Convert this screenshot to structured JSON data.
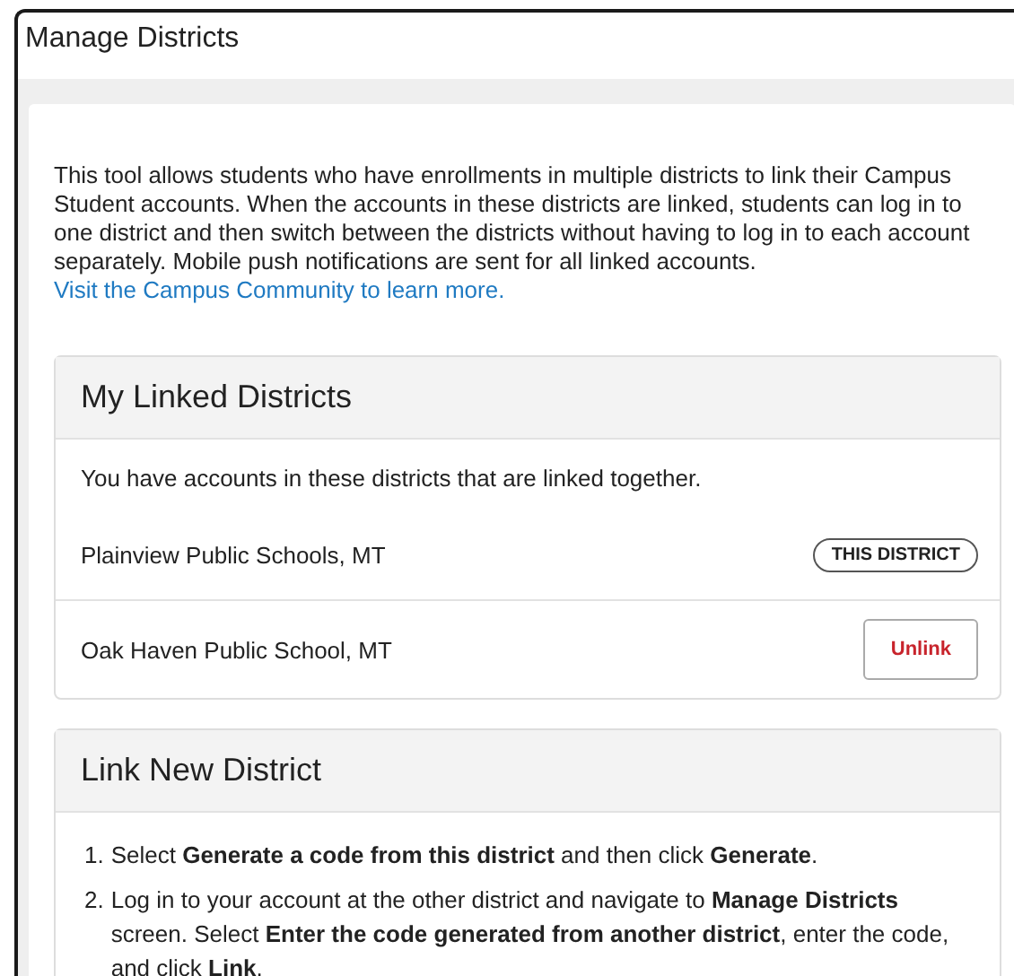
{
  "page": {
    "title": "Manage Districts"
  },
  "intro": {
    "text": "This tool allows students who have enrollments in multiple districts to link their Campus Student accounts. When the accounts in these districts are linked, students can log in to one district and then switch between the districts without having to log in to each account separately.  Mobile push notifications are sent for all linked accounts.",
    "link": "Visit the Campus Community to learn more."
  },
  "linked_districts": {
    "title": "My Linked Districts",
    "description": "You have accounts in these districts that are linked together.",
    "rows": [
      {
        "name": "Plainview Public Schools, MT",
        "kind": "badge",
        "action": "THIS DISTRICT"
      },
      {
        "name": "Oak Haven Public School, MT",
        "kind": "button",
        "action": "Unlink"
      }
    ]
  },
  "link_new": {
    "title": "Link New District",
    "steps": [
      {
        "number": "1.",
        "text": "Select **Generate a code from this district** and then click **Generate**."
      },
      {
        "number": "2.",
        "text": "Log in to your account at the other district and navigate to **Manage Districts** screen. Select **Enter the code generated from another district**, enter the code, and click **Link**."
      }
    ]
  }
}
